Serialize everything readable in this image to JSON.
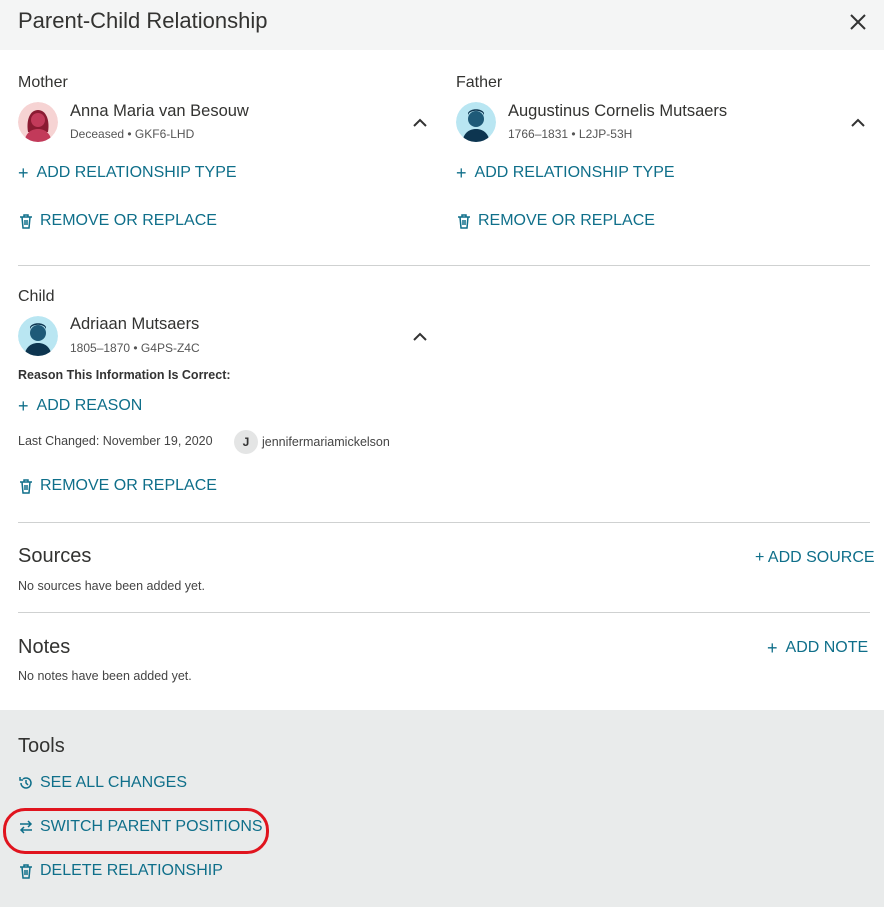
{
  "dialog": {
    "title": "Parent-Child Relationship"
  },
  "mother": {
    "label": "Mother",
    "name": "Anna Maria van Besouw",
    "meta": "Deceased • GKF6-LHD",
    "add_relationship_type": "ADD RELATIONSHIP TYPE",
    "remove_or_replace": "REMOVE OR REPLACE"
  },
  "father": {
    "label": "Father",
    "name": "Augustinus Cornelis Mutsaers",
    "meta": "1766–1831 • L2JP-53H",
    "add_relationship_type": "ADD RELATIONSHIP TYPE",
    "remove_or_replace": "REMOVE OR REPLACE"
  },
  "child": {
    "label": "Child",
    "name": "Adriaan Mutsaers",
    "meta": "1805–1870 • G4PS-Z4C",
    "reason_label": "Reason This Information Is Correct:",
    "add_reason": "ADD REASON",
    "last_changed": "Last Changed: November 19, 2020",
    "user_initial": "J",
    "user_name": "jennifermariamickelson",
    "remove_or_replace": "REMOVE OR REPLACE"
  },
  "sources": {
    "title": "Sources",
    "add_label": "+ ADD SOURCE",
    "empty": "No sources have been added yet."
  },
  "notes": {
    "title": "Notes",
    "add_label": "ADD NOTE",
    "empty": "No notes have been added yet."
  },
  "tools": {
    "title": "Tools",
    "see_all_changes": "SEE ALL CHANGES",
    "switch_parent_positions": "SWITCH PARENT POSITIONS",
    "delete_relationship": "DELETE RELATIONSHIP"
  },
  "colors": {
    "link": "#0f6f8a",
    "highlight": "#e0141e",
    "header_bg": "#f4f5f5",
    "tools_bg": "#e9ebeb"
  }
}
